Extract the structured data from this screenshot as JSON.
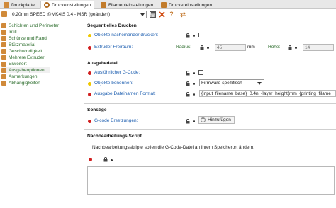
{
  "tabs": [
    {
      "label": "Druckplatte",
      "icon": "printer-bed-icon"
    },
    {
      "label": "Druckeinstellungen",
      "icon": "gear-icon"
    },
    {
      "label": "Filamenteinstellungen",
      "icon": "spool-icon"
    },
    {
      "label": "Druckereinstellungen",
      "icon": "printer-icon"
    }
  ],
  "preset": {
    "value": "0.20mm SPEED @MK4IS 0.4 - MSR (geändert)"
  },
  "toolbar": {
    "save_glyph": "💾",
    "delete_glyph": "✕",
    "help_glyph": "?",
    "compare_glyph": "⇄"
  },
  "sidebar": {
    "items": [
      {
        "label": "Schichten und Perimeter"
      },
      {
        "label": "Infill"
      },
      {
        "label": "Schürze und Rand"
      },
      {
        "label": "Stützmaterial"
      },
      {
        "label": "Geschwindigkeit"
      },
      {
        "label": "Mehrere Extruder"
      },
      {
        "label": "Erweitert"
      },
      {
        "label": "Ausgabeoptionen"
      },
      {
        "label": "Anmerkungen"
      },
      {
        "label": "Abhängigkeiten"
      }
    ]
  },
  "sections": {
    "sequential": {
      "title": "Sequentielles Drucken",
      "objects_label": "Objekte nacheinander drucken:",
      "extruder_label": "Extruder Freiraum:",
      "radius_label": "Radius:",
      "radius_value": "45",
      "radius_unit": "mm",
      "height_label": "Höhe:",
      "height_value": "14",
      "height_unit": "mm"
    },
    "output": {
      "title": "Ausgabedatei",
      "verbose_label": "Ausführlicher G-Code:",
      "label_objects_label": "Objekte benennen:",
      "label_objects_value": "Firmware-spezifisch",
      "filename_label": "Ausgabe Dateinamen Format:",
      "filename_value": "{input_filename_base}_0.4n_{layer_height}mm_{printing_filame"
    },
    "other": {
      "title": "Sonstige",
      "gcode_label": "G-code Ersetzungen:",
      "add_button": "Hinzufügen"
    },
    "postprocess": {
      "title": "Nachbearbeitungs Script",
      "description": "Nachbearbeitungsskripte sollen die G-Code-Datei an ihrem Speicherort ändern."
    }
  },
  "colors": {
    "accent_label": "#1e5fb0",
    "nav_text": "#2e6e2e",
    "dot_red": "#d11f1f",
    "dot_yellow": "#f0c800",
    "icon_orange": "#d08a3a"
  }
}
